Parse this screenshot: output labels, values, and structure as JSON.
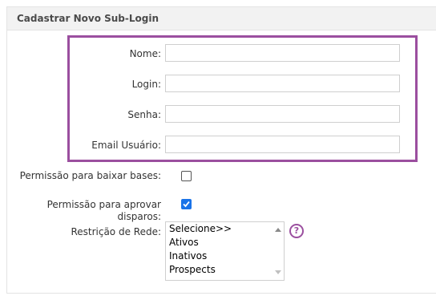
{
  "panel": {
    "title": "Cadastrar Novo Sub-Login"
  },
  "fields": {
    "nome": {
      "label": "Nome:",
      "value": ""
    },
    "login": {
      "label": "Login:",
      "value": ""
    },
    "senha": {
      "label": "Senha:",
      "value": ""
    },
    "email": {
      "label": "Email Usuário:",
      "value": ""
    }
  },
  "permissions": {
    "baixar_bases": {
      "label": "Permissão para baixar bases:",
      "checked": false
    },
    "aprovar_disparos": {
      "label_line1": "Permissão para aprovar",
      "label_line2": "disparos:",
      "checked": true
    }
  },
  "rede": {
    "label": "Restrição de Rede:",
    "options": [
      "Selecione>>",
      "Ativos",
      "Inativos",
      "Prospects"
    ]
  },
  "help": {
    "glyph": "?"
  },
  "colors": {
    "accent": "#9b4f9f",
    "checkbox": "#1a73e8"
  }
}
